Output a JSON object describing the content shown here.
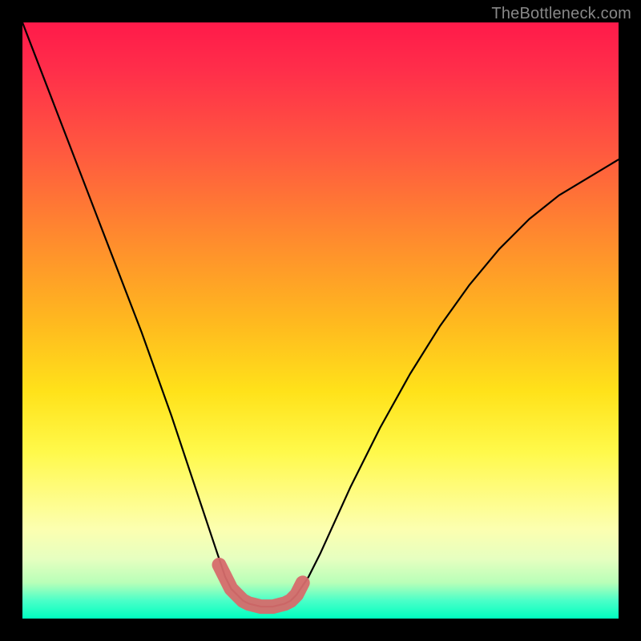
{
  "watermark": "TheBottleneck.com",
  "chart_data": {
    "type": "line",
    "title": "",
    "xlabel": "",
    "ylabel": "",
    "xlim": [
      0,
      100
    ],
    "ylim": [
      0,
      100
    ],
    "series": [
      {
        "name": "curve",
        "x": [
          0,
          5,
          10,
          15,
          20,
          25,
          28,
          30,
          32,
          34,
          35,
          36,
          37,
          38,
          40,
          42,
          44,
          45,
          46,
          48,
          50,
          55,
          60,
          65,
          70,
          75,
          80,
          85,
          90,
          95,
          100
        ],
        "values": [
          100,
          87,
          74,
          61,
          48,
          34,
          25,
          19,
          13,
          7,
          5,
          4,
          3,
          2.5,
          2,
          2,
          2.5,
          3,
          4,
          7,
          11,
          22,
          32,
          41,
          49,
          56,
          62,
          67,
          71,
          74,
          77
        ]
      }
    ],
    "highlight": {
      "name": "trough-marker",
      "color": "#d66b6b",
      "x": [
        33,
        34,
        35,
        36,
        37,
        38,
        40,
        42,
        44,
        45,
        46,
        47
      ],
      "values": [
        9,
        7,
        5,
        4,
        3,
        2.5,
        2,
        2,
        2.5,
        3,
        4,
        6
      ]
    },
    "gradient_stops": [
      {
        "pct": 0,
        "color": "#ff1a4a"
      },
      {
        "pct": 50,
        "color": "#ffe21a"
      },
      {
        "pct": 100,
        "color": "#00ffc0"
      }
    ]
  }
}
